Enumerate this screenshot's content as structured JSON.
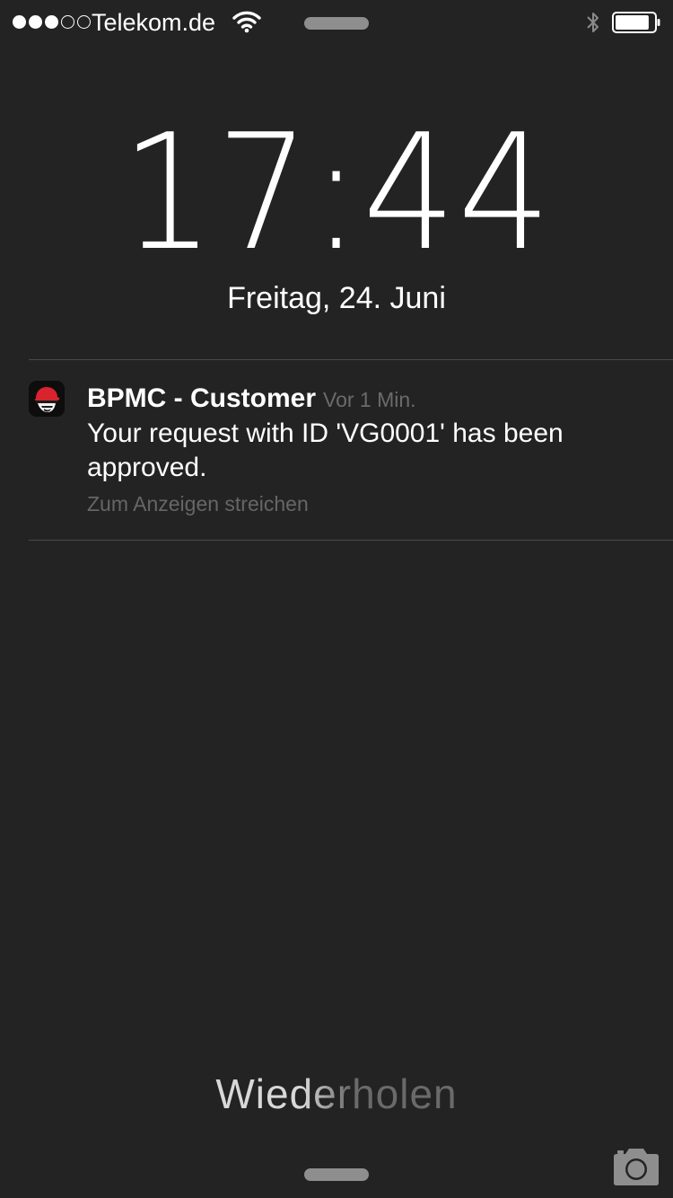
{
  "status_bar": {
    "signal_strength": 3,
    "signal_max": 5,
    "carrier": "Telekom.de",
    "wifi_icon": "wifi-icon",
    "bluetooth_icon": "bluetooth-icon",
    "battery_level": 0.9
  },
  "lock_screen": {
    "time": "17:44",
    "date": "Freitag, 24. Juni"
  },
  "notification": {
    "app_icon": "red-hat-icon",
    "app_name": "BPMC - Customer",
    "time": "Vor 1 Min.",
    "message": "Your request with ID 'VG0001' has been approved.",
    "hint": "Zum Anzeigen streichen"
  },
  "bottom": {
    "prompt": "Wiederholen",
    "camera_icon": "camera-icon"
  },
  "colors": {
    "background": "#232323",
    "text_primary": "#ffffff",
    "text_secondary": "#6b6b6b",
    "divider": "#4a4a4a",
    "grabber": "#8e8e8e",
    "red_hat": "#d9232e"
  }
}
